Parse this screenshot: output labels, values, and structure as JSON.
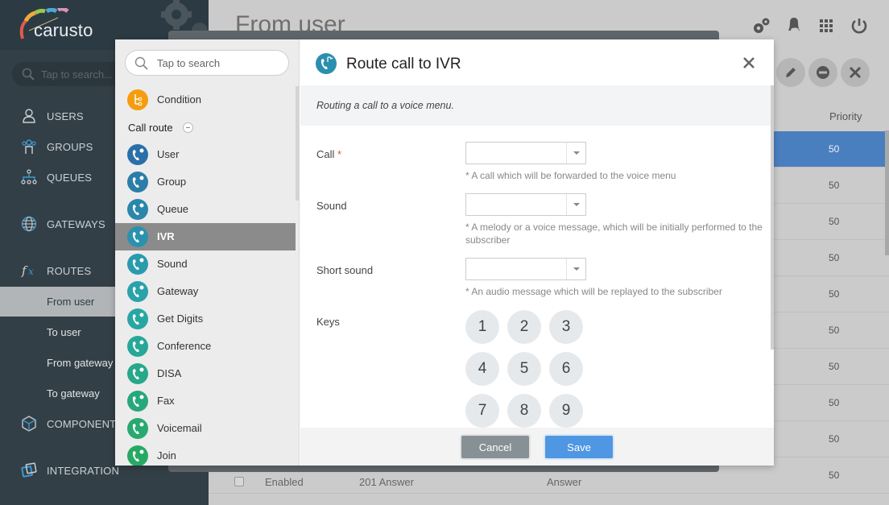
{
  "app": {
    "logo_text": "carusto",
    "search_placeholder": "Tap to search..."
  },
  "nav": {
    "items": [
      {
        "label": "USERS",
        "icon": "user-icon"
      },
      {
        "label": "GROUPS",
        "icon": "group-icon"
      },
      {
        "label": "QUEUES",
        "icon": "queue-icon"
      },
      {
        "label": "GATEWAYS",
        "icon": "globe-icon"
      },
      {
        "label": "ROUTES",
        "icon": "function-icon"
      },
      {
        "label": "COMPONENTS",
        "icon": "cube-icon"
      },
      {
        "label": "INTEGRATION",
        "icon": "integration-icon"
      }
    ],
    "routes_sub": [
      {
        "label": "From user",
        "active": true
      },
      {
        "label": "To user",
        "active": false
      },
      {
        "label": "From gateway",
        "active": false
      },
      {
        "label": "To gateway",
        "active": false
      }
    ]
  },
  "main": {
    "title": "From user",
    "top_icons": [
      "settings-icon",
      "notifications-icon",
      "apps-icon",
      "power-icon"
    ],
    "action_buttons": [
      "edit-icon",
      "disable-icon",
      "delete-icon"
    ],
    "column_priority": "Priority",
    "rows": [
      {
        "priority": "50",
        "selected": true
      },
      {
        "priority": "50"
      },
      {
        "priority": "50"
      },
      {
        "priority": "50"
      },
      {
        "priority": "50"
      },
      {
        "priority": "50"
      },
      {
        "priority": "50"
      },
      {
        "priority": "50"
      },
      {
        "priority": "50"
      },
      {
        "priority": "50",
        "status": "Enabled",
        "name": "201 Answer",
        "action": "Answer"
      }
    ]
  },
  "modal": {
    "search_placeholder": "Tap to search",
    "condition_label": "Condition",
    "group_label": "Call route",
    "components": [
      {
        "label": "User",
        "color": "#2b6fa8"
      },
      {
        "label": "Group",
        "color": "#2a7ea9"
      },
      {
        "label": "Queue",
        "color": "#2a86aa"
      },
      {
        "label": "IVR",
        "color": "#2a92ad",
        "active": true
      },
      {
        "label": "Sound",
        "color": "#2a9aac"
      },
      {
        "label": "Gateway",
        "color": "#29a2aa"
      },
      {
        "label": "Get Digits",
        "color": "#28a7a2"
      },
      {
        "label": "Conference",
        "color": "#27a897"
      },
      {
        "label": "DISA",
        "color": "#27a88a"
      },
      {
        "label": "Fax",
        "color": "#27a87c"
      },
      {
        "label": "Voicemail",
        "color": "#27a96f"
      },
      {
        "label": "Join",
        "color": "#27a964"
      }
    ],
    "title": "Route call to IVR",
    "description": "Routing a call to a voice menu.",
    "fields": [
      {
        "label": "Call",
        "required": true,
        "value": "",
        "hint": "* A call which will be forwarded to the voice menu"
      },
      {
        "label": "Sound",
        "required": false,
        "value": "",
        "hint": "* A melody or a voice message, which will be initially performed to the subscriber"
      },
      {
        "label": "Short sound",
        "required": false,
        "value": "",
        "hint": "* An audio message which will be replayed to the subscriber"
      }
    ],
    "keys_label": "Keys",
    "keys": [
      "1",
      "2",
      "3",
      "4",
      "5",
      "6",
      "7",
      "8",
      "9"
    ],
    "cancel_label": "Cancel",
    "save_label": "Save",
    "required_mark": "*"
  }
}
